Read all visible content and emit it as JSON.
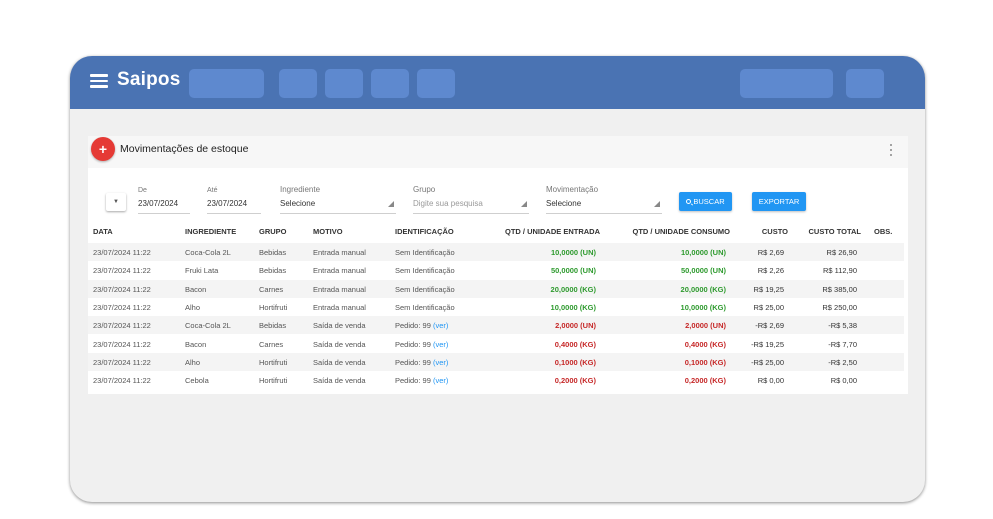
{
  "app": {
    "name": "Saipos"
  },
  "icons": {
    "menu": "hamburger-icon",
    "add": "plus-icon",
    "more": "kebab-icon",
    "collapse": "chevron-down-icon",
    "search": "search-icon"
  },
  "colors": {
    "topbar": "#4a73b3",
    "accent": "#2196f3",
    "fab": "#e53a35",
    "positive": "#2e9a2e",
    "negative": "#c62828"
  },
  "page": {
    "title": "Movimentações de estoque",
    "add_symbol": "+"
  },
  "filters": {
    "from": {
      "label": "De",
      "value": "23/07/2024"
    },
    "to": {
      "label": "Até",
      "value": "23/07/2024"
    },
    "ingredient": {
      "label": "Ingrediente",
      "value": "Selecione"
    },
    "group": {
      "label": "Grupo",
      "placeholder": "Digite sua pesquisa"
    },
    "movement": {
      "label": "Movimentação",
      "value": "Selecione"
    },
    "search_button": "BUSCAR",
    "export_button": "EXPORTAR"
  },
  "table": {
    "headers": [
      "DATA",
      "INGREDIENTE",
      "GRUPO",
      "MOTIVO",
      "IDENTIFICAÇÃO",
      "QTD / UNIDADE ENTRADA",
      "QTD / UNIDADE CONSUMO",
      "CUSTO",
      "CUSTO TOTAL",
      "OBS."
    ],
    "rows": [
      {
        "date": "23/07/2024 11:22",
        "ingredient": "Coca-Cola 2L",
        "group": "Bebidas",
        "reason": "Entrada manual",
        "ident": "Sem Identificação",
        "ident_link": "",
        "qty_in": "10,0000 (UN)",
        "qty_use": "10,0000 (UN)",
        "cost": "R$ 2,69",
        "total": "R$ 26,90",
        "sign": "pos"
      },
      {
        "date": "23/07/2024 11:22",
        "ingredient": "Fruki Lata",
        "group": "Bebidas",
        "reason": "Entrada manual",
        "ident": "Sem Identificação",
        "ident_link": "",
        "qty_in": "50,0000 (UN)",
        "qty_use": "50,0000 (UN)",
        "cost": "R$ 2,26",
        "total": "R$ 112,90",
        "sign": "pos"
      },
      {
        "date": "23/07/2024 11:22",
        "ingredient": "Bacon",
        "group": "Carnes",
        "reason": "Entrada manual",
        "ident": "Sem Identificação",
        "ident_link": "",
        "qty_in": "20,0000 (KG)",
        "qty_use": "20,0000 (KG)",
        "cost": "R$ 19,25",
        "total": "R$ 385,00",
        "sign": "pos"
      },
      {
        "date": "23/07/2024 11:22",
        "ingredient": "Alho",
        "group": "Hortifruti",
        "reason": "Entrada manual",
        "ident": "Sem Identificação",
        "ident_link": "",
        "qty_in": "10,0000 (KG)",
        "qty_use": "10,0000 (KG)",
        "cost": "R$ 25,00",
        "total": "R$ 250,00",
        "sign": "pos"
      },
      {
        "date": "23/07/2024 11:22",
        "ingredient": "Coca-Cola 2L",
        "group": "Bebidas",
        "reason": "Saída de venda",
        "ident": "Pedido: 99",
        "ident_link": "(ver)",
        "qty_in": "2,0000 (UN)",
        "qty_use": "2,0000 (UN)",
        "cost": "-R$ 2,69",
        "total": "-R$ 5,38",
        "sign": "neg"
      },
      {
        "date": "23/07/2024 11:22",
        "ingredient": "Bacon",
        "group": "Carnes",
        "reason": "Saída de venda",
        "ident": "Pedido: 99",
        "ident_link": "(ver)",
        "qty_in": "0,4000 (KG)",
        "qty_use": "0,4000 (KG)",
        "cost": "-R$ 19,25",
        "total": "-R$ 7,70",
        "sign": "neg"
      },
      {
        "date": "23/07/2024 11:22",
        "ingredient": "Alho",
        "group": "Hortifruti",
        "reason": "Saída de venda",
        "ident": "Pedido: 99",
        "ident_link": "(ver)",
        "qty_in": "0,1000 (KG)",
        "qty_use": "0,1000 (KG)",
        "cost": "-R$ 25,00",
        "total": "-R$ 2,50",
        "sign": "neg"
      },
      {
        "date": "23/07/2024 11:22",
        "ingredient": "Cebola",
        "group": "Hortifruti",
        "reason": "Saída de venda",
        "ident": "Pedido: 99",
        "ident_link": "(ver)",
        "qty_in": "0,2000 (KG)",
        "qty_use": "0,2000 (KG)",
        "cost": "R$ 0,00",
        "total": "R$ 0,00",
        "sign": "neg"
      }
    ]
  }
}
